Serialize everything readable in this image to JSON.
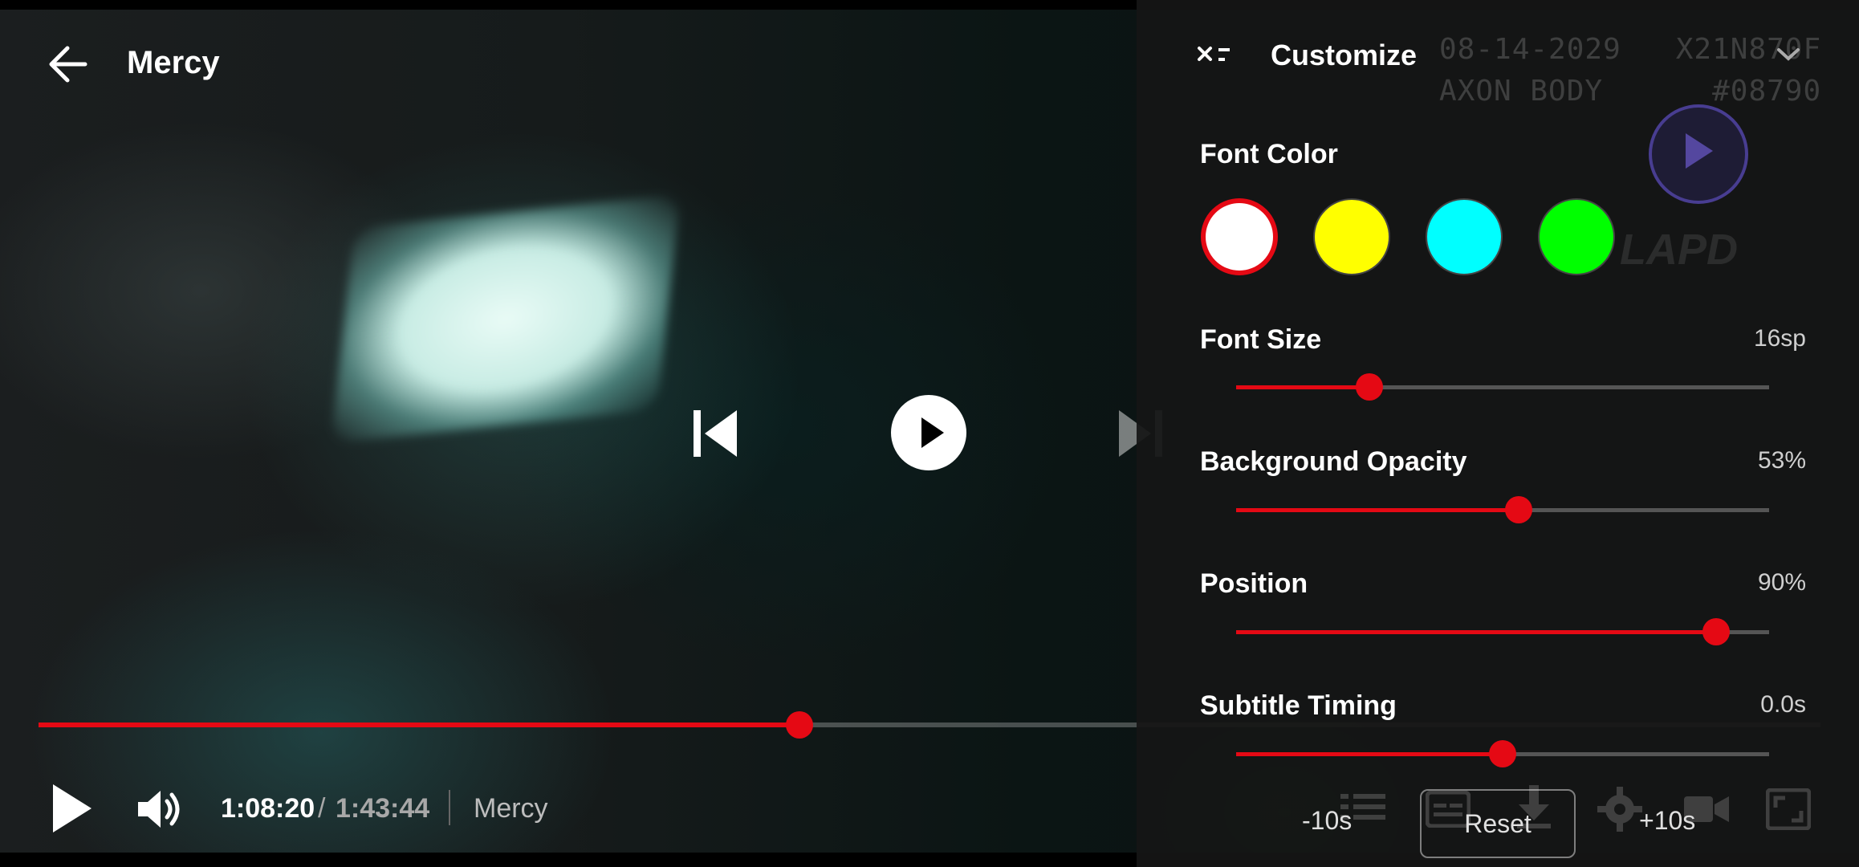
{
  "player": {
    "title": "Mercy",
    "current_time": "1:08:20",
    "separator": "/",
    "total_time": "1:43:44",
    "bottom_title": "Mercy",
    "progress_fraction": 0.427,
    "accent_color": "#e50914"
  },
  "icons": {
    "back": "arrow-left-icon",
    "prev": "skip-previous-icon",
    "play": "play-icon",
    "next": "skip-next-icon",
    "volume": "volume-icon",
    "close": "close-icon",
    "collapse": "chevron-down-icon"
  },
  "overlay": {
    "bodycam_text": "08-14-2029   X21N870F\nAXON BODY      #08790",
    "badge_text": "LAPD"
  },
  "customize": {
    "title": "Customize",
    "font_color": {
      "label": "Font Color",
      "options": [
        "#ffffff",
        "#ffff00",
        "#00ffff",
        "#00ff00"
      ],
      "selected_index": 0
    },
    "font_size": {
      "label": "Font Size",
      "value": "16sp",
      "fraction": 0.25
    },
    "background_opacity": {
      "label": "Background Opacity",
      "value": "53%",
      "fraction": 0.53
    },
    "position": {
      "label": "Position",
      "value": "90%",
      "fraction": 0.9
    },
    "subtitle_timing": {
      "label": "Subtitle Timing",
      "value": "0.0s",
      "fraction": 0.5
    },
    "minus_label": "-10s",
    "reset_label": "Reset",
    "plus_label": "+10s"
  }
}
